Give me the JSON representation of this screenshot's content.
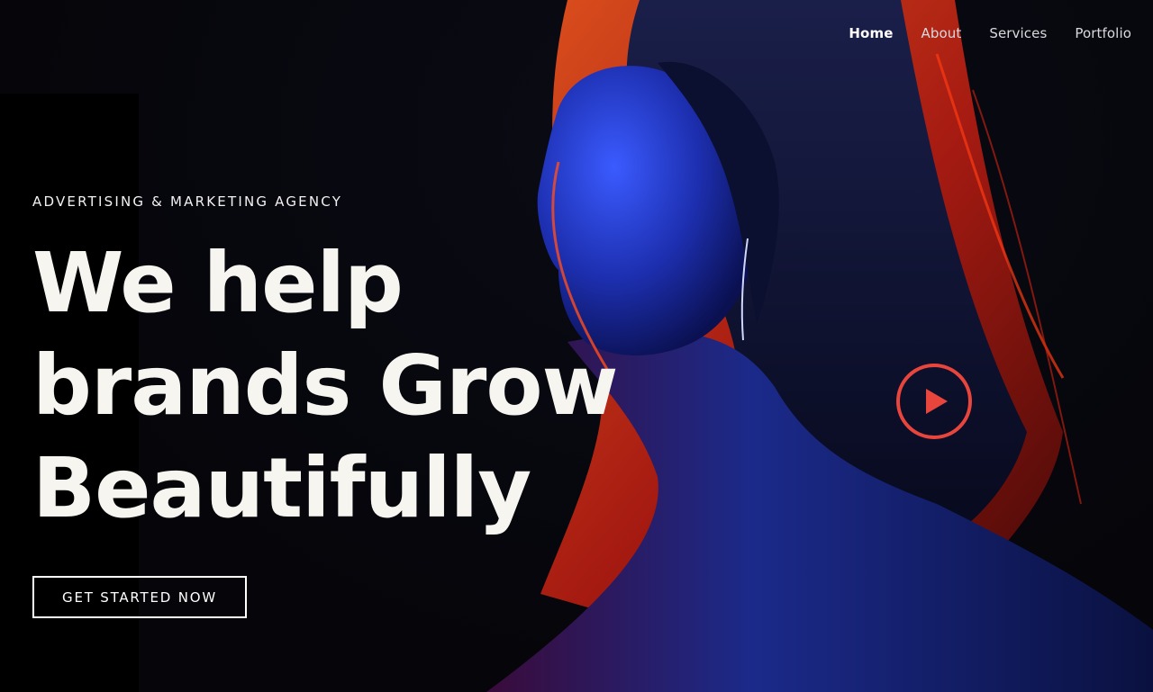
{
  "nav": {
    "items": [
      {
        "label": "Home",
        "active": true
      },
      {
        "label": "About",
        "active": false
      },
      {
        "label": "Services",
        "active": false
      },
      {
        "label": "Portfolio",
        "active": false
      }
    ]
  },
  "hero": {
    "tagline": "ADVERTISING & MARKETING AGENCY",
    "headline_line1": "We help",
    "headline_line2": "brands Grow",
    "headline_line3": "Beautifully",
    "cta_label": "GET STARTED NOW",
    "play_icon": "play-icon"
  },
  "colors": {
    "background": "#05050a",
    "text": "#f7f5ef",
    "accent_red": "#e8453c",
    "accent_blue": "#1f3fbf"
  }
}
